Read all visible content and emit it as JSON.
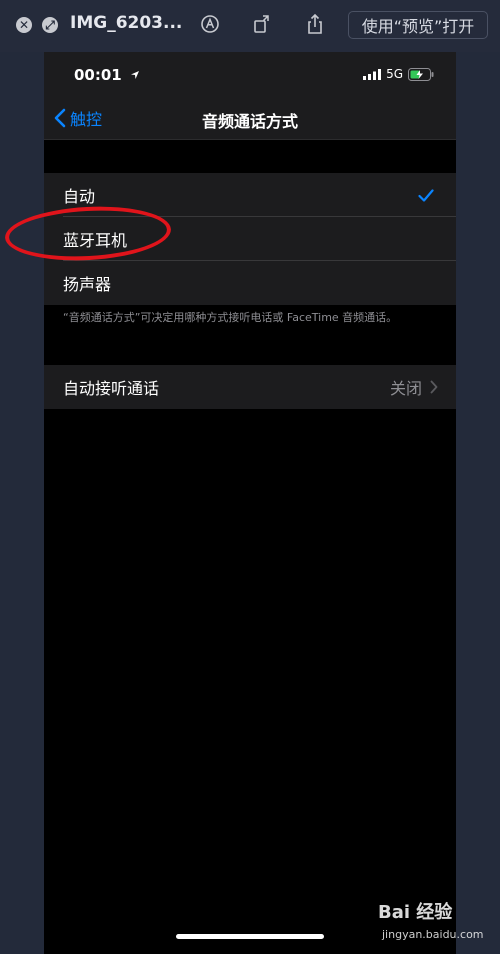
{
  "quicklook": {
    "title": "IMG_6203...",
    "open_button": "使用“预览”打开",
    "close_glyph": "✕",
    "fullscreen_glyph": "⤢",
    "icons": [
      "close-icon",
      "fullscreen-icon",
      "markup-icon",
      "rotate-icon",
      "share-icon"
    ]
  },
  "status_bar": {
    "time": "00:01",
    "network": "5G"
  },
  "nav": {
    "back_label": "触控",
    "title": "音频通话方式"
  },
  "options": [
    {
      "label": "自动",
      "selected": true
    },
    {
      "label": "蓝牙耳机",
      "selected": false
    },
    {
      "label": "扬声器",
      "selected": false
    }
  ],
  "footnote": "“音频通话方式”可决定用哪种方式接听电话或 FaceTime 音频通话。",
  "auto_answer": {
    "label": "自动接听通话",
    "value": "关闭"
  },
  "watermark": {
    "brand": "Bai 经验",
    "url": "jingyan.baidu.com"
  },
  "colors": {
    "accent": "#0a84ff",
    "annotation": "#e0141b",
    "cell_bg": "#1c1c1e"
  }
}
